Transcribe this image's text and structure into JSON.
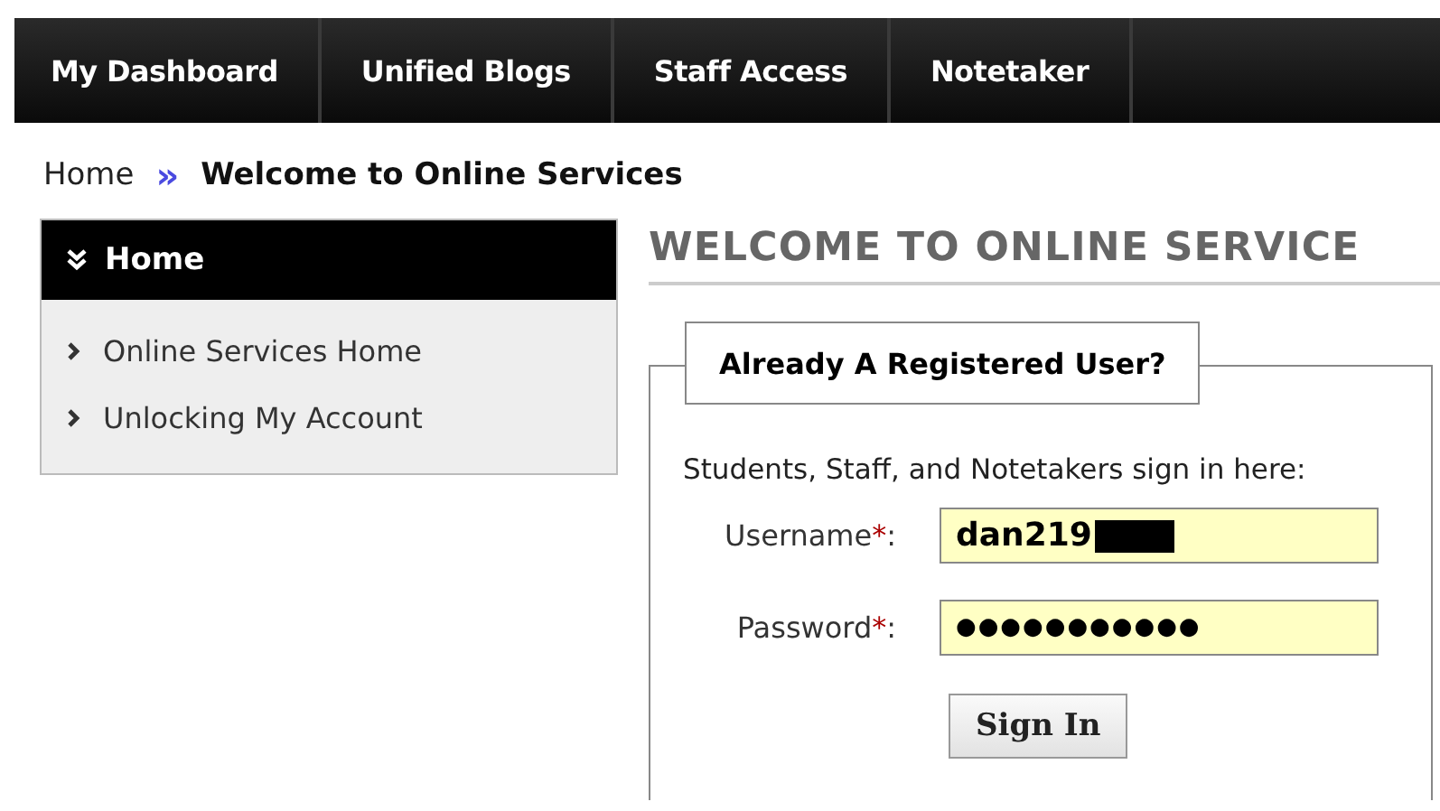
{
  "nav": {
    "tabs": [
      {
        "label": "My Dashboard"
      },
      {
        "label": "Unified Blogs"
      },
      {
        "label": "Staff Access"
      },
      {
        "label": "Notetaker"
      }
    ]
  },
  "breadcrumb": {
    "items": [
      "Home",
      "Welcome to Online Services"
    ],
    "separator": "»"
  },
  "sidebar": {
    "title": "Home",
    "expanded": true,
    "items": [
      {
        "label": "Online Services Home"
      },
      {
        "label": "Unlocking My Account"
      }
    ]
  },
  "main": {
    "heading": "WELCOME TO ONLINE SERVICE",
    "login": {
      "legend": "Already A Registered User?",
      "intro": "Students, Staff, and Notetakers sign in here:",
      "fields": [
        {
          "label": "Username",
          "required_mark": "*",
          "colon": ":",
          "value": "dan219",
          "redacted": true
        },
        {
          "label": "Password",
          "required_mark": "*",
          "colon": ":",
          "value": "●●●●●●●●●●●",
          "redacted": false
        }
      ],
      "button": "Sign In"
    }
  }
}
